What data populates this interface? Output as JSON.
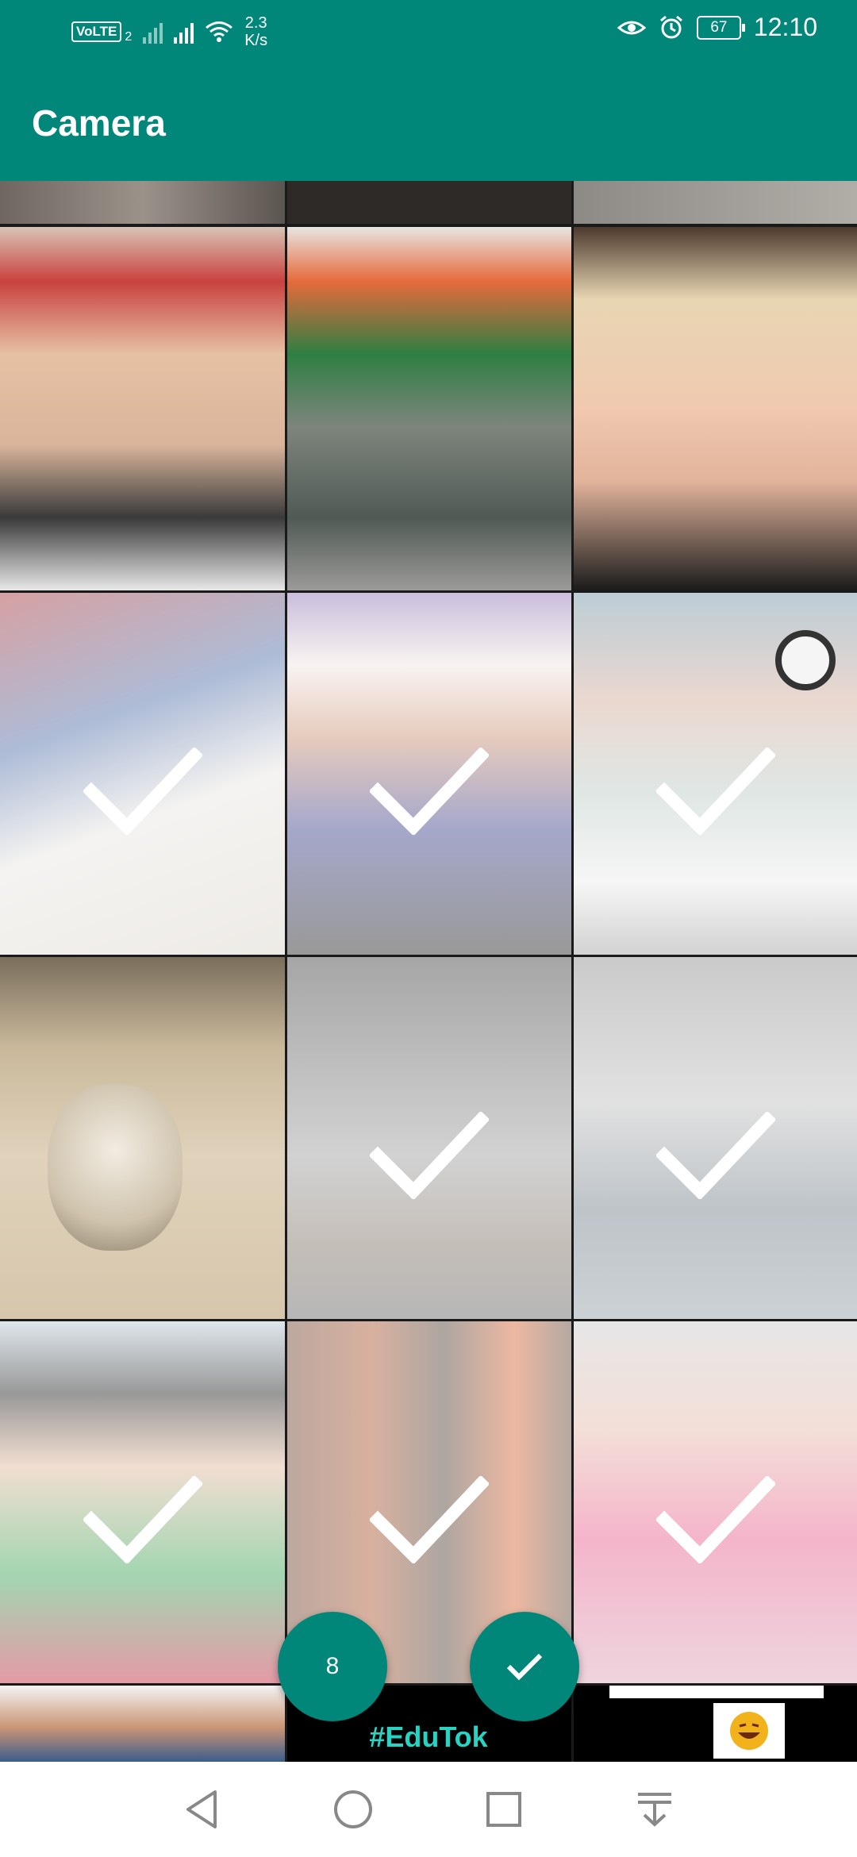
{
  "status_bar": {
    "network_badge": "VoLTE",
    "sim_index": "2",
    "speed_value": "2.3",
    "speed_unit": "K/s",
    "battery": "67",
    "time": "12:10",
    "icons": [
      "signal-icon",
      "signal-icon",
      "wifi-icon",
      "eye-icon",
      "alarm-icon",
      "battery-icon"
    ]
  },
  "app_bar": {
    "title": "Camera"
  },
  "grid": {
    "cells": [
      {
        "id": "top-1",
        "selected": false
      },
      {
        "id": "top-2",
        "selected": false
      },
      {
        "id": "top-3",
        "selected": false
      },
      {
        "id": "r1c1",
        "selected": false
      },
      {
        "id": "r1c2",
        "selected": false
      },
      {
        "id": "r1c3",
        "selected": false
      },
      {
        "id": "r2c1",
        "selected": true
      },
      {
        "id": "r2c2",
        "selected": true
      },
      {
        "id": "r2c3",
        "selected": true
      },
      {
        "id": "r3c1",
        "selected": false
      },
      {
        "id": "r3c2",
        "selected": true
      },
      {
        "id": "r3c3",
        "selected": true
      },
      {
        "id": "r4c1",
        "selected": true
      },
      {
        "id": "r4c2",
        "selected": true
      },
      {
        "id": "r4c3",
        "selected": true
      },
      {
        "id": "bottom-1",
        "selected": false
      },
      {
        "id": "bottom-2",
        "selected": false
      },
      {
        "id": "bottom-3",
        "selected": false
      }
    ]
  },
  "banner_text": "#EduTok",
  "fab": {
    "selected_count": "8",
    "confirm_icon": "check-icon"
  },
  "nav_bar": {
    "icons": [
      "back-icon",
      "home-icon",
      "recents-icon",
      "notification-pull-icon"
    ]
  },
  "colors": {
    "primary": "#00877a",
    "check": "#ffffff"
  }
}
